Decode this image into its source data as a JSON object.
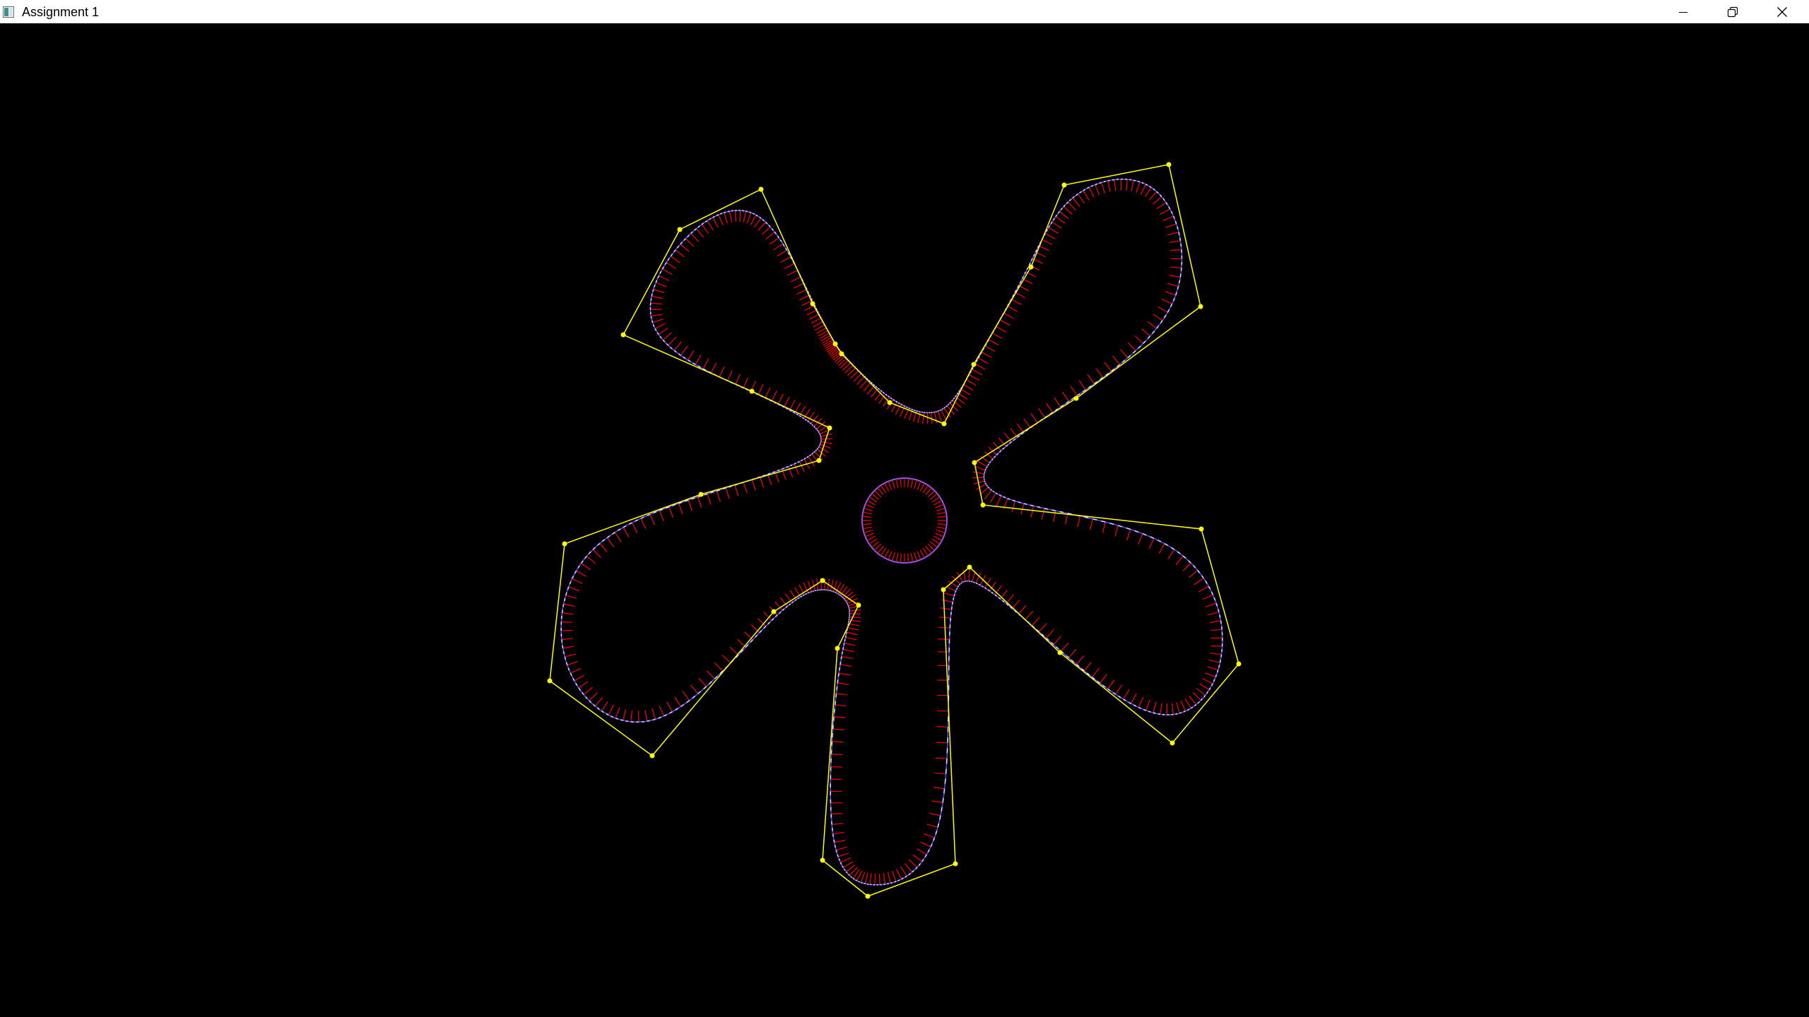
{
  "window": {
    "title": "Assignment 1",
    "app_icon": "window-app-icon",
    "controls": {
      "minimize_icon": "minimize-icon",
      "maximize_icon": "restore-icon",
      "close_icon": "close-icon"
    }
  },
  "scene": {
    "background_color": "#000000",
    "control_polygon_color": "#ffff00",
    "control_point_color": "#ffff00",
    "curve_color_a": "#c8e6ff",
    "curve_color_b": "#6a3cff",
    "normal_color": "#ff0000",
    "center_circle_color": "#8a5cff"
  }
}
